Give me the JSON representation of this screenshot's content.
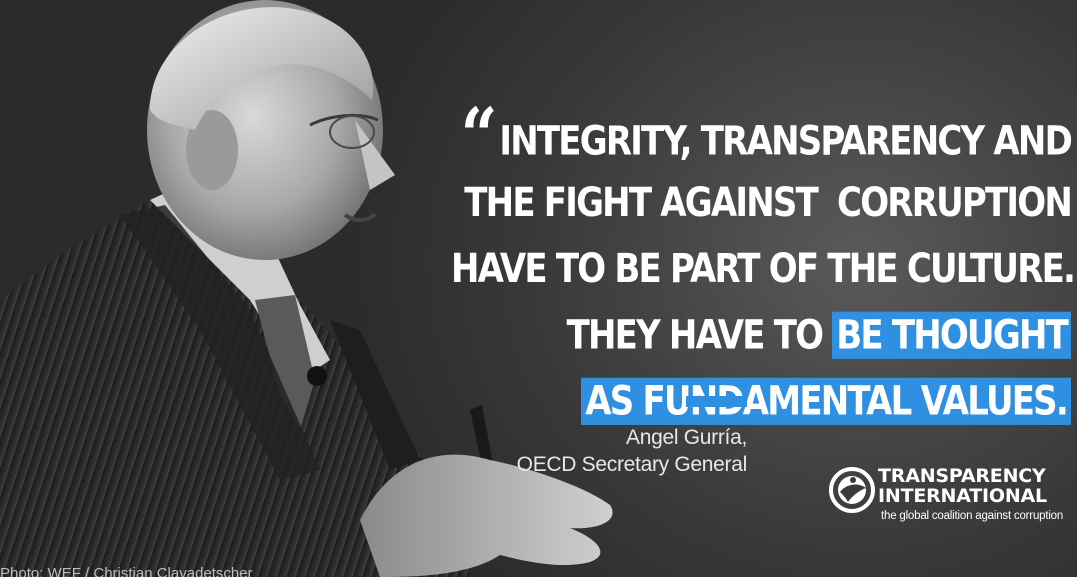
{
  "quote": {
    "open_mark": "“",
    "line1": "INTEGRITY, TRANSPARENCY AND",
    "line2": "THE FIGHT AGAINST  CORRUPTION",
    "line3": "HAVE TO BE PART OF THE CULTURE.",
    "line4_plain": "THEY HAVE TO ",
    "line4_highlight": "BE THOUGHT",
    "line5_highlight": "AS FUNDAMENTAL VALUES."
  },
  "attribution": {
    "name": "Angel Gurría,",
    "role": "OECD Secretary General"
  },
  "logo": {
    "icon": "transparency-international-globe-icon",
    "name_line1": "TRANSPARENCY",
    "name_line2": "INTERNATIONAL",
    "tagline": "the global coalition against corruption"
  },
  "photo_credit": "Photo: WEF / Christian Clavadetscher",
  "colors": {
    "accent_blue": "#2f8fe0",
    "background": "#3a3a3a",
    "text": "#ffffff"
  }
}
